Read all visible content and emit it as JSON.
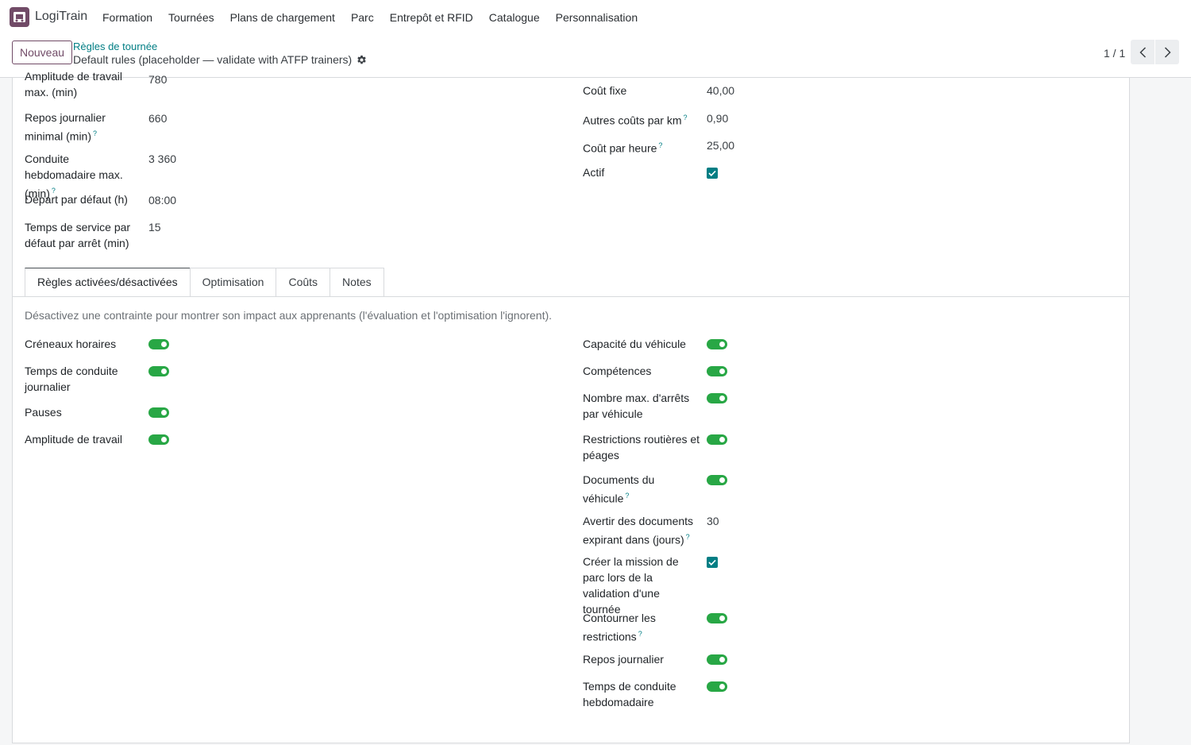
{
  "navbar": {
    "app_icon": "truck-box-icon",
    "app_name": "LogiTrain",
    "menu": [
      "Formation",
      "Tournées",
      "Plans de chargement",
      "Parc",
      "Entrepôt et RFID",
      "Catalogue",
      "Personnalisation"
    ]
  },
  "control": {
    "new_label": "Nouveau",
    "breadcrumb_parent": "Règles de tournée",
    "breadcrumb_current": "Default rules (placeholder — validate with ATFP trainers)",
    "pager": "1 / 1"
  },
  "fields_left": [
    {
      "label": "Amplitude de travail max. (min)",
      "value": "780"
    },
    {
      "label": "Repos journalier minimal (min)",
      "value": "660",
      "help": "?"
    },
    {
      "label": "Conduite hebdomadaire max. (min)",
      "value": "3 360",
      "help": "?"
    },
    {
      "label": "Départ par défaut (h)",
      "value": "08:00"
    },
    {
      "label": "Temps de service par défaut par arrêt (min)",
      "value": "15"
    }
  ],
  "fields_right": [
    {
      "label": "Coût fixe",
      "value": "40,00"
    },
    {
      "label": "Autres coûts par km",
      "value": "0,90",
      "help": "?"
    },
    {
      "label": "Coût par heure",
      "value": "25,00",
      "help": "?"
    },
    {
      "label": "Actif",
      "checked": true
    }
  ],
  "tabs": [
    "Règles activées/désactivées",
    "Optimisation",
    "Coûts",
    "Notes"
  ],
  "active_tab": "Règles activées/désactivées",
  "tab_hint": "Désactivez une contrainte pour montrer son impact aux apprenants (l'évaluation et l'optimisation l'ignorent).",
  "rules_left": [
    {
      "label": "Créneaux horaires",
      "on": true
    },
    {
      "label": "Temps de conduite journalier",
      "on": true
    },
    {
      "label": "Pauses",
      "on": true
    },
    {
      "label": "Amplitude de travail",
      "on": true
    }
  ],
  "rules_right": [
    {
      "label": "Capacité du véhicule",
      "on": true
    },
    {
      "label": "Compétences",
      "on": true
    },
    {
      "label": "Nombre max. d'arrêts par véhicule",
      "on": true
    },
    {
      "label": "Restrictions routières et péages",
      "on": true
    },
    {
      "label": "Documents du véhicule",
      "help": "?",
      "on": true
    },
    {
      "label": "Avertir des documents expirant dans (jours)",
      "help": "?",
      "value": "30"
    },
    {
      "label": "Créer la mission de parc lors de la validation d'une tournée",
      "checked": true
    },
    {
      "label": "Contourner les restrictions",
      "help": "?",
      "on": true
    },
    {
      "label": "Repos journalier",
      "on": true
    },
    {
      "label": "Temps de conduite hebdomadaire",
      "on": true
    }
  ],
  "colors": {
    "brand": "#714b67",
    "accent": "#017e84",
    "toggle_on": "#28a745"
  }
}
